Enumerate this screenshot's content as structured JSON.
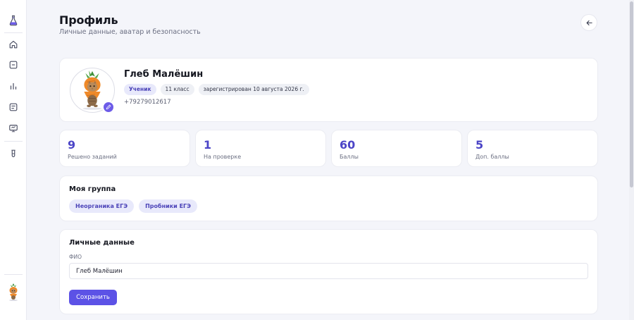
{
  "header": {
    "title": "Профиль",
    "subtitle": "Личные данные, аватар и безопасность"
  },
  "sidebar": {
    "items": [
      {
        "icon": "flask-logo-icon"
      },
      {
        "icon": "home-icon"
      },
      {
        "icon": "tasks-icon"
      },
      {
        "icon": "stats-icon"
      },
      {
        "icon": "list-icon"
      },
      {
        "icon": "presentation-icon"
      },
      {
        "icon": "test-tube-icon"
      }
    ],
    "user_avatar": "carrot-cat-avatar"
  },
  "profile": {
    "name": "Глеб Малёшин",
    "role": "Ученик",
    "grade": "11 класс",
    "registered": "зарегистрирован 10 августа 2026 г.",
    "phone": "+79279012617"
  },
  "stats": [
    {
      "value": "9",
      "label": "Решено заданий"
    },
    {
      "value": "1",
      "label": "На проверке"
    },
    {
      "value": "60",
      "label": "Баллы"
    },
    {
      "value": "5",
      "label": "Доп. баллы"
    }
  ],
  "group": {
    "title": "Моя группа",
    "items": [
      "Неорганика ЕГЭ",
      "Пробники ЕГЭ"
    ]
  },
  "personal": {
    "title": "Личные данные",
    "fio_label": "ФИО",
    "fio_value": "Глеб Малёшин",
    "save_label": "Сохранить"
  },
  "colors": {
    "accent": "#5c52e6",
    "stat_value": "#4c45c7",
    "chip_bg": "#e8e9fb"
  }
}
